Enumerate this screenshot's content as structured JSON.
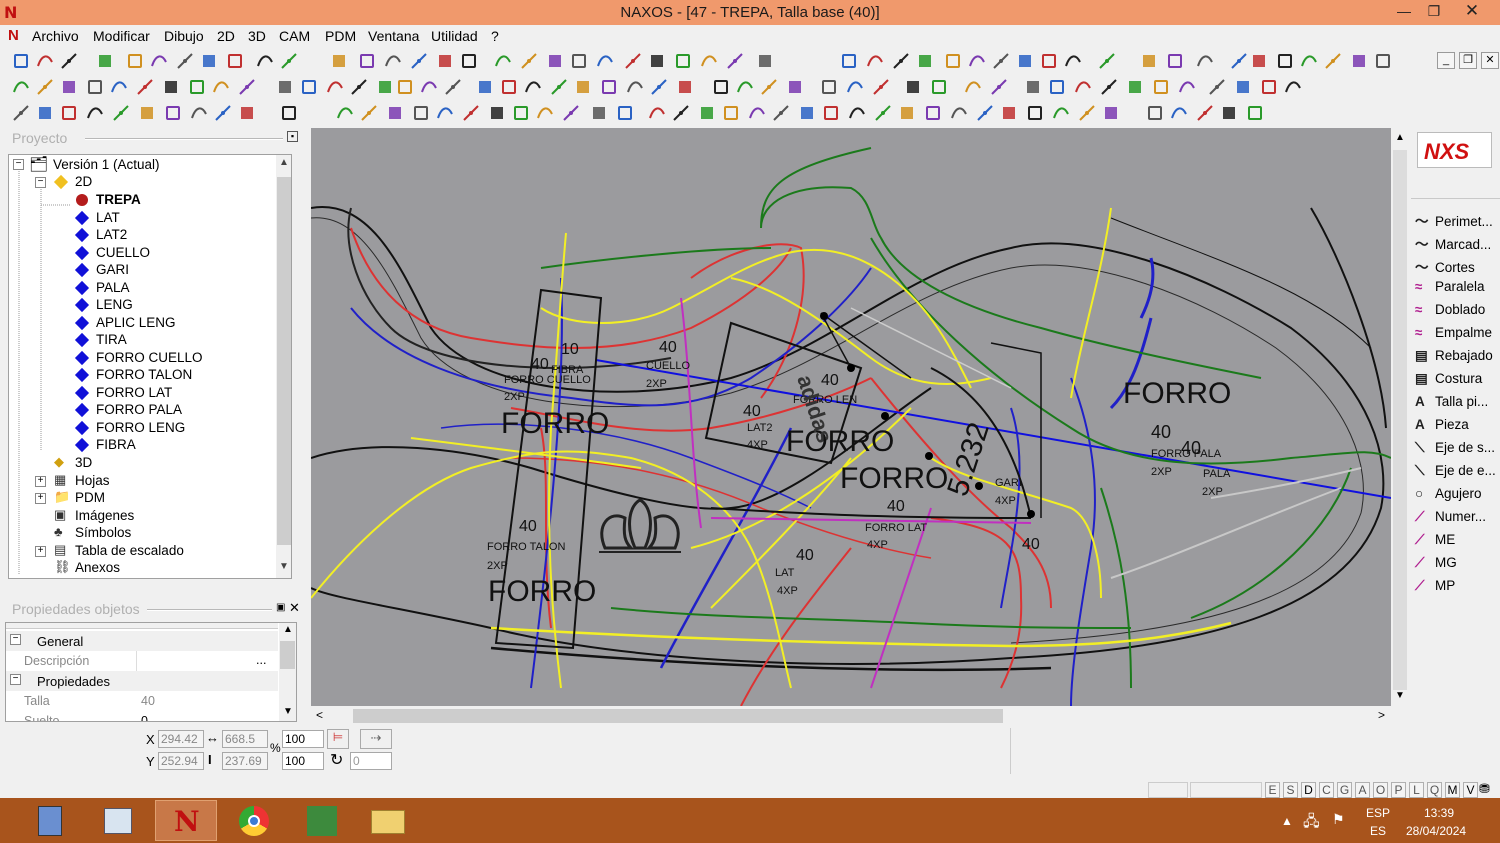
{
  "window": {
    "title": "NAXOS - [47 - TREPA, Talla base (40)]"
  },
  "menu": [
    "Archivo",
    "Modificar",
    "Dibujo",
    "2D",
    "3D",
    "CAM",
    "PDM",
    "Ventana",
    "Utilidad",
    "?"
  ],
  "project_panel": {
    "title": "Proyecto",
    "version": "Versión 1 (Actual)",
    "node_2d": "2D",
    "pieces": [
      "TREPA",
      "LAT",
      "LAT2",
      "CUELLO",
      "GARI",
      "PALA",
      "LENG",
      "APLIC LENG",
      "TIRA",
      "FORRO CUELLO",
      "FORRO TALON",
      "FORRO LAT",
      "FORRO PALA",
      "FORRO LENG",
      "FIBRA"
    ],
    "other_nodes": [
      "3D",
      "Hojas",
      "PDM",
      "Imágenes",
      "Símbolos",
      "Tabla de escalado",
      "Anexos"
    ]
  },
  "properties_panel": {
    "title": "Propiedades objetos",
    "general": "General",
    "desc_label": "Descripción",
    "props": "Propiedades",
    "talla_label": "Talla",
    "talla_value": "40",
    "suelto_label": "Suelto",
    "suelto_value": "0"
  },
  "canvas": {
    "labels": [
      {
        "t": "FORRO"
      },
      {
        "t": "40"
      },
      {
        "t": "40"
      },
      {
        "t": "FORRO PALA"
      },
      {
        "t": "2XP"
      },
      {
        "t": "PALA"
      },
      {
        "t": "2XP"
      },
      {
        "t": "FORRO"
      },
      {
        "t": "10"
      },
      {
        "t": "40"
      },
      {
        "t": "FIBRA"
      },
      {
        "t": "FORRO CUELLO"
      },
      {
        "t": "2XP"
      },
      {
        "t": "40"
      },
      {
        "t": "CUELLO"
      },
      {
        "t": "2XP"
      },
      {
        "t": "40"
      },
      {
        "t": "LAT2"
      },
      {
        "t": "4XP"
      },
      {
        "t": "FORRO"
      },
      {
        "t": "40"
      },
      {
        "t": "FORRO LEN"
      },
      {
        "t": "FORRO"
      },
      {
        "t": "40"
      },
      {
        "t": "FORRO LAT"
      },
      {
        "t": "4XP"
      },
      {
        "t": "40"
      },
      {
        "t": "LAT"
      },
      {
        "t": "4XP"
      },
      {
        "t": "40"
      },
      {
        "t": "FORRO TALON"
      },
      {
        "t": "2XP"
      },
      {
        "t": "FORRO"
      },
      {
        "t": "GARI"
      },
      {
        "t": "4XP"
      },
      {
        "t": "40"
      },
      {
        "t": "5.232"
      },
      {
        "t": "adidas"
      }
    ]
  },
  "tools_panel": {
    "items": [
      "Perimet...",
      "Marcad...",
      "Cortes",
      "Paralela",
      "Doblado",
      "Empalme",
      "Rebajado",
      "Costura",
      "Talla pi...",
      "Pieza",
      "Eje de s...",
      "Eje de e...",
      "Agujero",
      "Numer...",
      "ME",
      "MG",
      "MP"
    ]
  },
  "coords": {
    "x_label": "X",
    "y_label": "Y",
    "x": "294.42",
    "y": "252.94",
    "w": "668.5",
    "h": "237.69",
    "sx": "100",
    "sy": "100",
    "pct": "%",
    "rot": "0"
  },
  "status_letters": [
    "E",
    "S",
    "D",
    "C",
    "G",
    "A",
    "O",
    "P",
    "L",
    "Q",
    "M",
    "V"
  ],
  "tray": {
    "lang1": "ESP",
    "lang2": "ES",
    "time": "13:39",
    "date": "28/04/2024"
  },
  "colors": {
    "titlebar": "#f0996c",
    "canvas": "#9b9b9e",
    "taskbar": "#a8541c",
    "accent": "#c01010"
  }
}
